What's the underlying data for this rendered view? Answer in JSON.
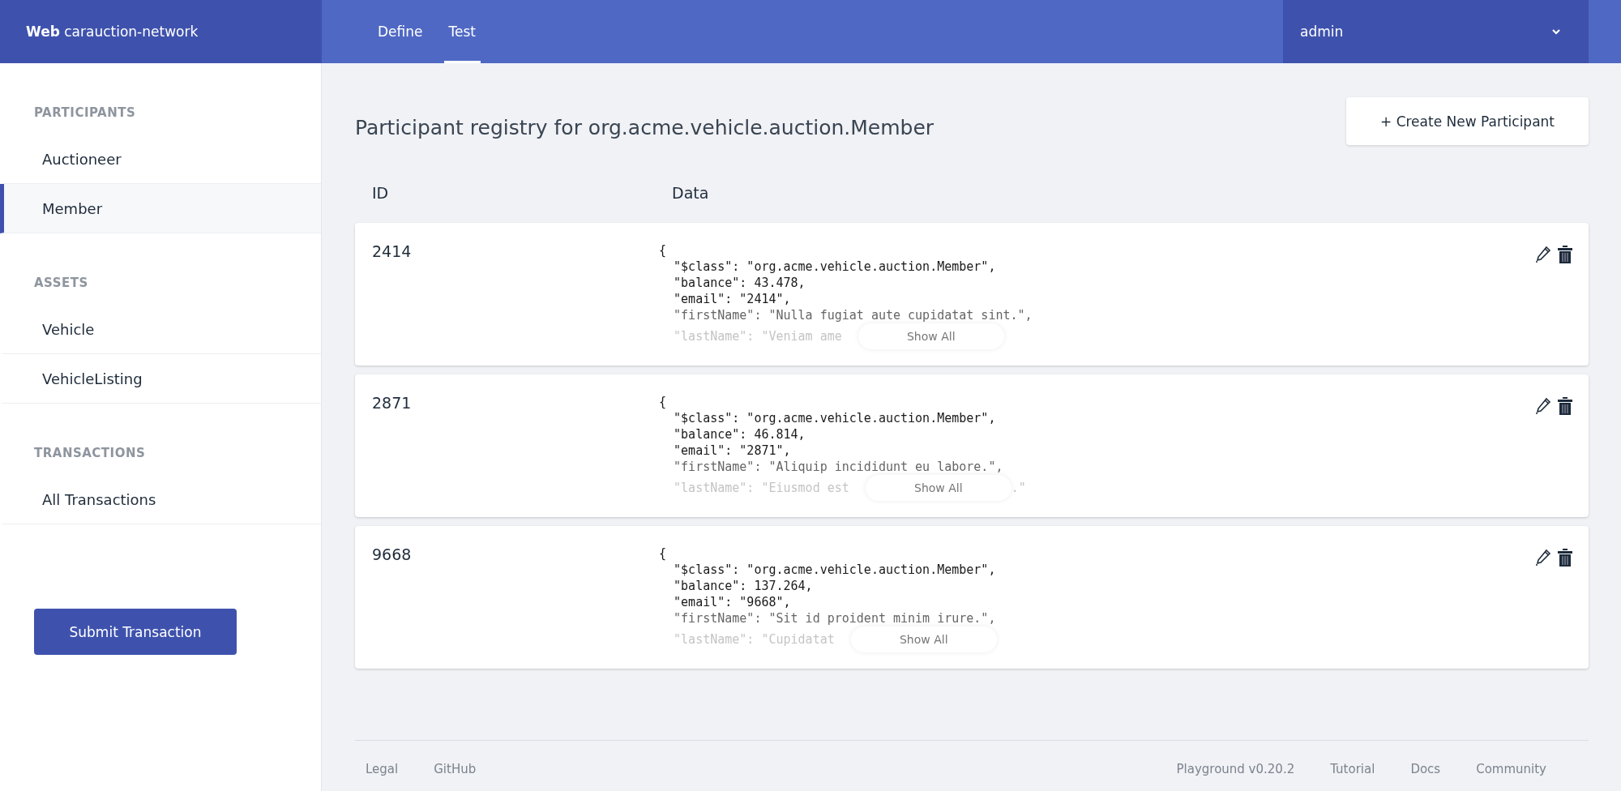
{
  "header": {
    "brand_bold": "Web",
    "brand_name": "carauction-network",
    "tabs": [
      {
        "label": "Define",
        "selected": false
      },
      {
        "label": "Test",
        "selected": true
      }
    ],
    "user": "admin"
  },
  "sidebar": {
    "sections": [
      {
        "heading": "PARTICIPANTS",
        "items": [
          {
            "label": "Auctioneer",
            "selected": false
          },
          {
            "label": "Member",
            "selected": true
          }
        ]
      },
      {
        "heading": "ASSETS",
        "items": [
          {
            "label": "Vehicle",
            "selected": false
          },
          {
            "label": "VehicleListing",
            "selected": false
          }
        ]
      },
      {
        "heading": "TRANSACTIONS",
        "items": [
          {
            "label": "All Transactions",
            "selected": false
          }
        ]
      }
    ],
    "submit_button": "Submit Transaction"
  },
  "main": {
    "title": "Participant registry for org.acme.vehicle.auction.Member",
    "create_button": "+ Create New Participant",
    "columns": [
      "ID",
      "Data"
    ],
    "rows": [
      {
        "id": "2414",
        "lines": [
          "{",
          "  \"$class\": \"org.acme.vehicle.auction.Member\",",
          "  \"balance\": 43.478,",
          "  \"email\": \"2414\",",
          "  \"firstName\": \"Nulla fugiat aute cupidatat sint.\","
        ],
        "cut_line": "  \"lastName\": \"Veniam ame",
        "show_all": "Show All"
      },
      {
        "id": "2871",
        "lines": [
          "{",
          "  \"$class\": \"org.acme.vehicle.auction.Member\",",
          "  \"balance\": 46.814,",
          "  \"email\": \"2871\",",
          "  \"firstName\": \"Aliquip incididunt eu labore.\","
        ],
        "cut_line": "  \"lastName\": \"Eiusmod est",
        "tail": ".\"",
        "show_all": "Show All"
      },
      {
        "id": "9668",
        "lines": [
          "{",
          "  \"$class\": \"org.acme.vehicle.auction.Member\",",
          "  \"balance\": 137.264,",
          "  \"email\": \"9668\",",
          "  \"firstName\": \"Sit id proident minim irure.\","
        ],
        "cut_line": "  \"lastName\": \"Cupidatat",
        "show_all": "Show All"
      }
    ]
  },
  "footer": {
    "left": [
      "Legal",
      "GitHub"
    ],
    "version": "Playground v0.20.2",
    "right": [
      "Tutorial",
      "Docs",
      "Community"
    ]
  }
}
